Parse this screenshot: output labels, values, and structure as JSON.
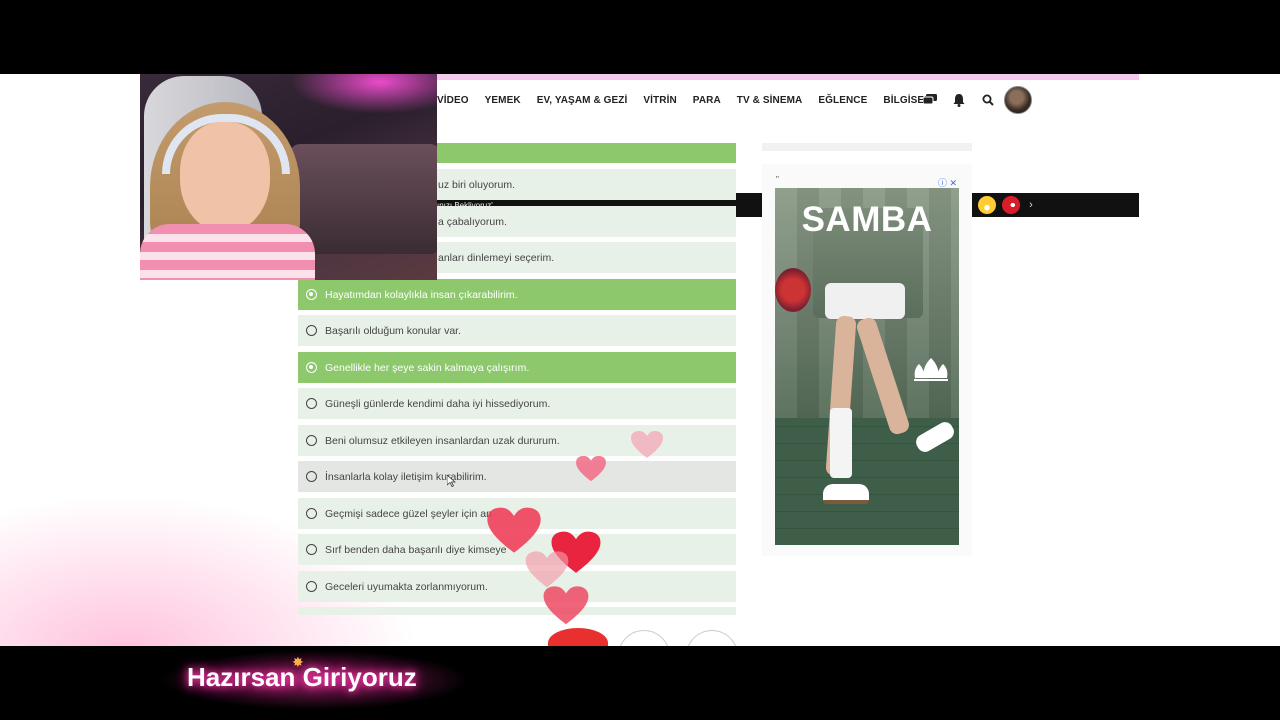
{
  "nav": {
    "items": [
      "VİDEO",
      "YEMEK",
      "EV, YAŞAM & GEZİ",
      "VİTRİN",
      "PARA",
      "TV & SİNEMA",
      "EĞLENCE",
      "BİLGİSEL"
    ],
    "icons": [
      "comments-icon",
      "bell-icon",
      "search-icon"
    ]
  },
  "ticker": {
    "text": "ınızı Bekliyoruz'",
    "prev": "‹",
    "next": "›"
  },
  "survey": {
    "options": [
      {
        "label": "",
        "selected": true
      },
      {
        "label": "uz biri oluyorum.",
        "selected": false
      },
      {
        "label": "a çabalıyorum.",
        "selected": false
      },
      {
        "label": "anları dinlemeyi seçerim.",
        "selected": false
      },
      {
        "label": "Hayatımdan kolaylıkla insan çıkarabilirim.",
        "selected": true
      },
      {
        "label": "Başarılı olduğum konular var.",
        "selected": false
      },
      {
        "label": "Genellikle her şeye sakin kalmaya çalışırım.",
        "selected": true
      },
      {
        "label": "Güneşli günlerde kendimi daha iyi hissediyorum.",
        "selected": false
      },
      {
        "label": "Beni olumsuz etkileyen insanlardan uzak dururum.",
        "selected": false
      },
      {
        "label": "İnsanlarla kolay iletişim kurabilirim.",
        "selected": false
      },
      {
        "label": "Geçmişi sadece güzel şeyler için an",
        "selected": false
      },
      {
        "label": "Sırf benden daha başarılı diye kimseye",
        "selected": false
      },
      {
        "label": "Geceleri uyumakta zorlanmıyorum.",
        "selected": false
      }
    ]
  },
  "ad": {
    "title": "SAMBA",
    "quote": "\"",
    "badge": "ⓘ ✕"
  },
  "banner": {
    "text": "Hazırsan Giriyoruz"
  }
}
